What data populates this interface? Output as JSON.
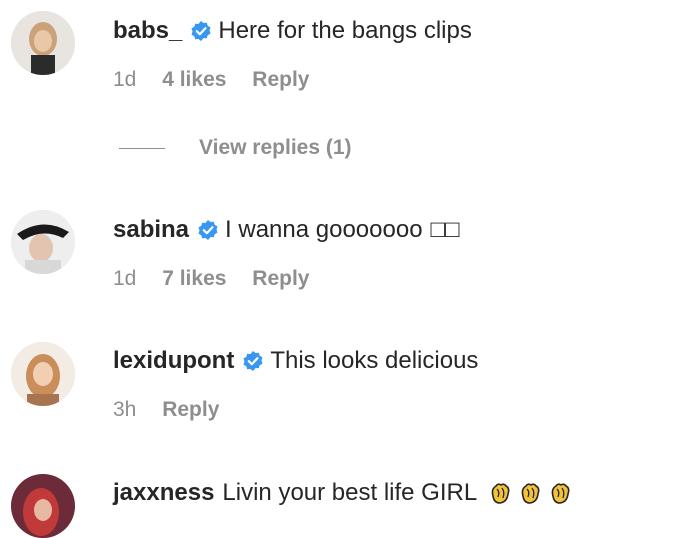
{
  "comments": [
    {
      "username": "babs_",
      "verified": true,
      "text": "Here for the bangs clips",
      "time": "1d",
      "likes": "4 likes",
      "reply": "Reply",
      "view_replies": "View replies (1)"
    },
    {
      "username": "sabina",
      "verified": true,
      "text": "I wanna gooooooo",
      "emoji_glyphs": "□□",
      "time": "1d",
      "likes": "7 likes",
      "reply": "Reply"
    },
    {
      "username": "lexidupont",
      "verified": true,
      "text": "This looks delicious",
      "time": "3h",
      "reply": "Reply"
    },
    {
      "username": "jaxxness",
      "verified": false,
      "text": "Livin your best life GIRL",
      "emoji": [
        "clapping-hands",
        "clapping-hands",
        "clapping-hands"
      ]
    }
  ],
  "colors": {
    "verified_badge": "#3897f0",
    "meta_text": "#8e8e8e",
    "primary_text": "#262626"
  }
}
